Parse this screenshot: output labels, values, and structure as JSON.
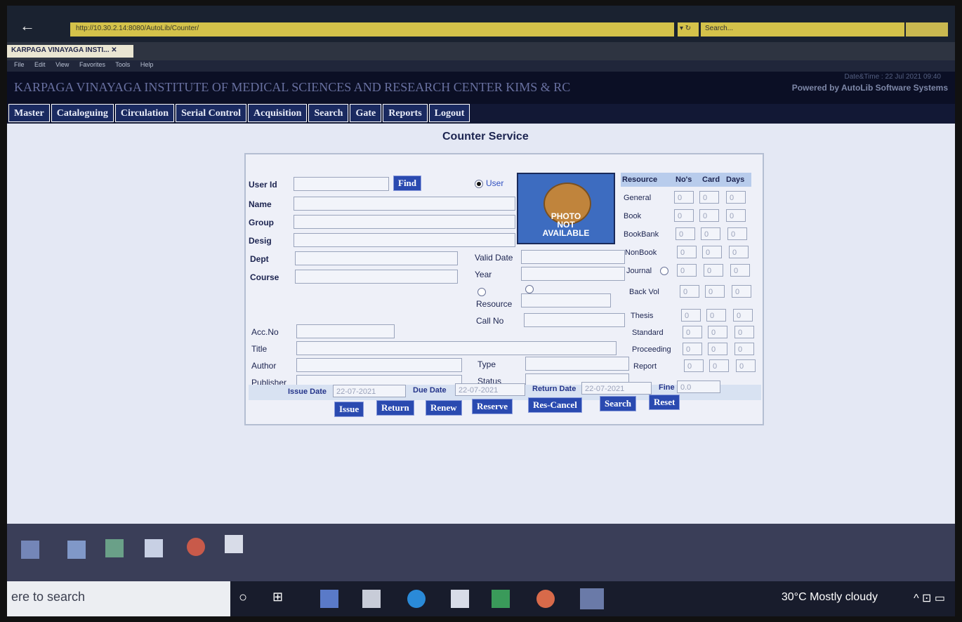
{
  "browser": {
    "url": "http://10.30.2.14:8080/AutoLib/Counter/",
    "search_placeholder": "Search...",
    "tab_title": "KARPAGA VINAYAGA INSTI... ✕",
    "menu": [
      "File",
      "Edit",
      "View",
      "Favorites",
      "Tools",
      "Help"
    ]
  },
  "header": {
    "institute": "KARPAGA VINAYAGA INSTITUTE OF MEDICAL SCIENCES AND RESEARCH CENTER KIMS & RC",
    "datetime": "Date&Time : 22 Jul 2021 09:40",
    "powered_by": "Powered by AutoLib Software Systems"
  },
  "nav": [
    "Master",
    "Cataloguing",
    "Circulation",
    "Serial Control",
    "Acquisition",
    "Search",
    "Gate",
    "Reports",
    "Logout"
  ],
  "page_title": "Counter Service",
  "form": {
    "user_id_label": "User Id",
    "find_label": "Find",
    "user_radio_label": "User",
    "labels": {
      "name": "Name",
      "group": "Group",
      "desig": "Desig",
      "dept": "Dept",
      "course": "Course",
      "valid_date": "Valid Date",
      "year": "Year",
      "resource": "Resource",
      "call_no": "Call No",
      "acc_no": "Acc.No",
      "title": "Title",
      "author": "Author",
      "publisher": "Publisher",
      "type": "Type",
      "status": "Status"
    },
    "photo_text": [
      "PHOTO",
      "NOT",
      "AVAILABLE"
    ],
    "dates": {
      "issue_label": "Issue Date",
      "issue_value": "22-07-2021",
      "due_label": "Due Date",
      "due_value": "22-07-2021",
      "return_label": "Return Date",
      "return_value": "22-07-2021",
      "fine_label": "Fine",
      "fine_value": "0.0"
    },
    "buttons": [
      "Issue",
      "Return",
      "Renew",
      "Reserve",
      "Res-Cancel",
      "Search",
      "Reset"
    ]
  },
  "resource_table": {
    "headers": [
      "Resource",
      "No's",
      "Card",
      "Days"
    ],
    "rows": [
      {
        "label": "General",
        "values": [
          "0",
          "0",
          "0"
        ]
      },
      {
        "label": "Book",
        "values": [
          "0",
          "0",
          "0"
        ]
      },
      {
        "label": "BookBank",
        "values": [
          "0",
          "0",
          "0"
        ]
      },
      {
        "label": "NonBook",
        "values": [
          "0",
          "0",
          "0"
        ]
      },
      {
        "label": "Journal",
        "values": [
          "0",
          "0",
          "0"
        ]
      },
      {
        "label": "Back Vol",
        "values": [
          "0",
          "0",
          "0"
        ]
      },
      {
        "label": "Thesis",
        "values": [
          "0",
          "0",
          "0"
        ]
      },
      {
        "label": "Standard",
        "values": [
          "0",
          "0",
          "0"
        ]
      },
      {
        "label": "Proceeding",
        "values": [
          "0",
          "0",
          "0"
        ]
      },
      {
        "label": "Report",
        "values": [
          "0",
          "0",
          "0"
        ]
      }
    ]
  },
  "taskbar": {
    "search_placeholder": "ere to search",
    "weather": "30°C  Mostly cloudy",
    "tray": "^ ⊡ ▭"
  },
  "colors": {
    "nav_bg": "#1a2a60",
    "button_bg": "#2a4ab0",
    "header_bg": "#0b0f25"
  }
}
